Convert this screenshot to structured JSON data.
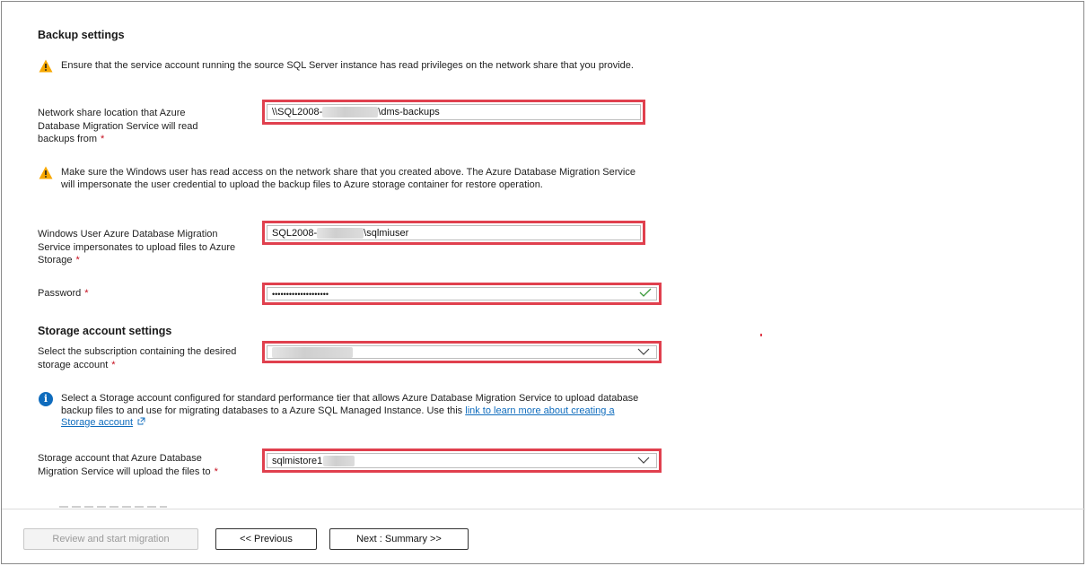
{
  "backup": {
    "title": "Backup settings",
    "warning1": "Ensure that the service account running the source SQL Server instance has read privileges on the network share that you provide.",
    "share_label": "Network share location that Azure Database Migration Service will read backups from",
    "share_value_prefix": "\\\\SQL2008-",
    "share_value_suffix": "\\dms-backups",
    "warning2": "Make sure the Windows user has read access on the network share that you created above. The Azure Database Migration Service will impersonate the user credential to upload the backup files to Azure storage container for restore operation.",
    "user_label": "Windows User Azure Database Migration Service impersonates to upload files to Azure Storage",
    "user_value_prefix": "SQL2008-",
    "user_value_suffix": "\\sqlmiuser",
    "password_label": "Password",
    "password_value": "••••••••••••••••••••",
    "required_mark": "*"
  },
  "storage": {
    "title": "Storage account settings",
    "subscription_label": "Select the subscription containing the desired storage account",
    "info_text": "Select a Storage account configured for standard performance tier that allows Azure Database Migration Service to upload database backup files to and use for migrating databases to a Azure SQL Managed Instance. Use this ",
    "info_link": "link to learn more about creating a Storage account",
    "account_label": "Storage account that Azure Database Migration Service will upload the files to",
    "account_value": "sqlmistore1"
  },
  "footer": {
    "review_label": "Review and start migration",
    "previous_label": "<< Previous",
    "next_label": "Next : Summary >>"
  },
  "colors": {
    "highlight": "#e0404e",
    "warning": "#f7a800",
    "info": "#0f6cbd"
  }
}
